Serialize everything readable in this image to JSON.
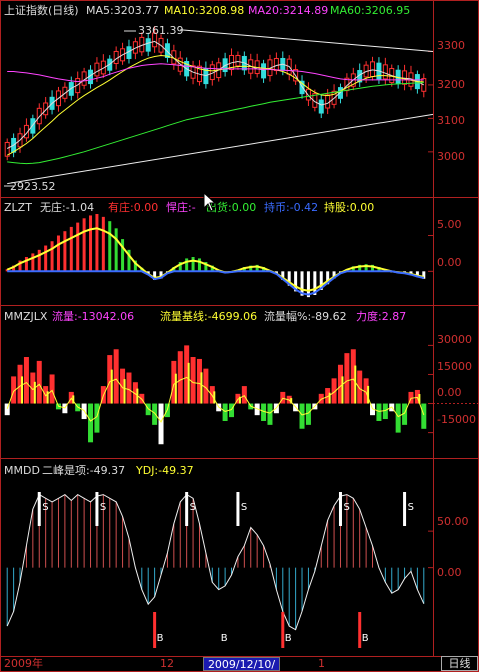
{
  "panels": {
    "main": {
      "title": "上证指数(日线)",
      "ma5": "MA5:3203.77",
      "ma10": "MA10:3208.98",
      "ma20": "MA20:3214.89",
      "ma60": "MA60:3206.95",
      "high_label": "3361.39",
      "low_label": "2923.52",
      "y_ticks": [
        "3300",
        "3200",
        "3100",
        "3000"
      ]
    },
    "zlzt": {
      "name": "ZLZT",
      "wuzhuang": "无庄:-1.04",
      "youzhuang": "有庄:0.00",
      "hanzhuang": "悍庄:-",
      "chuhuo": "出货:0.00",
      "shishi": "持币:-0.42",
      "chigu": "持股:0.00",
      "y_ticks": [
        "5.00",
        "0.00"
      ]
    },
    "mmzjlx": {
      "name": "MMZJLX",
      "liuliang": "流量:-13042.06",
      "jixian": "流量基线:-4699.06",
      "fu": "流量幅%:-89.62",
      "lidu": "力度:2.87",
      "y_ticks": [
        "30000",
        "15000",
        "0.00",
        "-15000"
      ]
    },
    "mmdd": {
      "name": "MMDD",
      "erfeng": "二峰是项:-49.37",
      "ydj": "YDJ:-49.37",
      "y_ticks": [
        "50.00",
        "0.00"
      ],
      "s_mark": "S",
      "b_mark": "B"
    }
  },
  "bottom_bar": {
    "year": "2009年",
    "m12": "12",
    "date": "2009/12/10/四",
    "m1": "1",
    "period": "日线"
  },
  "colors": {
    "up": "#ff3030",
    "down": "#33dddd",
    "green_bar": "#33dd33",
    "yellow": "#ffff33",
    "red_axis": "#b02020"
  },
  "chart_data": [
    {
      "type": "candlestick",
      "title": "上证指数(日线)",
      "ylim": [
        2880,
        3400
      ],
      "y_ticks": [
        3000,
        3100,
        3200,
        3300
      ],
      "series": [
        {
          "name": "MA5",
          "values": [
            3010,
            3020,
            3035,
            3055,
            3080,
            3105,
            3125,
            3145,
            3160,
            3175,
            3190,
            3200,
            3215,
            3228,
            3240,
            3250,
            3262,
            3278,
            3290,
            3300,
            3310,
            3318,
            3325,
            3330,
            3318,
            3300,
            3280,
            3262,
            3248,
            3238,
            3232,
            3228,
            3235,
            3245,
            3258,
            3266,
            3270,
            3266,
            3256,
            3248,
            3245,
            3250,
            3258,
            3262,
            3255,
            3228,
            3195,
            3168,
            3150,
            3140,
            3145,
            3160,
            3178,
            3198,
            3215,
            3230,
            3240,
            3245,
            3242,
            3235,
            3228,
            3222,
            3220,
            3218,
            3210,
            3200
          ]
        },
        {
          "name": "MA10",
          "values": [
            2990,
            3000,
            3012,
            3025,
            3040,
            3058,
            3075,
            3092,
            3110,
            3125,
            3140,
            3155,
            3168,
            3180,
            3192,
            3203,
            3215,
            3228,
            3240,
            3252,
            3262,
            3272,
            3280,
            3285,
            3288,
            3286,
            3280,
            3270,
            3262,
            3255,
            3248,
            3244,
            3242,
            3245,
            3248,
            3252,
            3255,
            3256,
            3255,
            3252,
            3250,
            3248,
            3245,
            3240,
            3232,
            3220,
            3205,
            3190,
            3178,
            3170,
            3168,
            3172,
            3182,
            3192,
            3202,
            3212,
            3220,
            3225,
            3228,
            3228,
            3226,
            3222,
            3218,
            3214,
            3210,
            3209
          ]
        },
        {
          "name": "MA20",
          "values": [
            3240,
            3240,
            3238,
            3236,
            3233,
            3230,
            3226,
            3222,
            3218,
            3215,
            3212,
            3210,
            3212,
            3215,
            3220,
            3225,
            3232,
            3238,
            3244,
            3250,
            3254,
            3258,
            3260,
            3262,
            3263,
            3262,
            3260,
            3258,
            3256,
            3254,
            3252,
            3250,
            3249,
            3248,
            3248,
            3248,
            3248,
            3248,
            3248,
            3248,
            3247,
            3246,
            3245,
            3244,
            3243,
            3242,
            3240,
            3237,
            3234,
            3230,
            3226,
            3222,
            3218,
            3216,
            3215,
            3215,
            3215,
            3215,
            3215,
            3215,
            3215,
            3215,
            3215,
            3215,
            3215,
            3215
          ]
        },
        {
          "name": "MA60",
          "values": [
            2970,
            2968,
            2966,
            2965,
            2966,
            2968,
            2972,
            2976,
            2980,
            2985,
            2990,
            2995,
            3000,
            3006,
            3012,
            3018,
            3024,
            3030,
            3036,
            3042,
            3048,
            3054,
            3060,
            3066,
            3072,
            3078,
            3084,
            3090,
            3096,
            3100,
            3104,
            3108,
            3112,
            3116,
            3120,
            3124,
            3128,
            3132,
            3136,
            3140,
            3144,
            3148,
            3151,
            3154,
            3157,
            3160,
            3163,
            3166,
            3169,
            3172,
            3175,
            3178,
            3181,
            3184,
            3187,
            3190,
            3193,
            3196,
            3198,
            3200,
            3202,
            3203,
            3204,
            3205,
            3206,
            3207
          ]
        }
      ],
      "annotations": [
        {
          "text": "3361.39",
          "value": 3361.39
        },
        {
          "text": "2923.52",
          "value": 2923.52
        }
      ]
    },
    {
      "type": "bar",
      "title": "ZLZT",
      "ylim": [
        -4,
        8
      ],
      "y_ticks": [
        0,
        5
      ],
      "series": [
        {
          "name": "无庄",
          "values": [
            0.3,
            0.8,
            1.5,
            2.0,
            2.5,
            3.0,
            3.6,
            4.2,
            5.0,
            5.6,
            6.2,
            6.8,
            7.4,
            7.8,
            8.0,
            7.6,
            7.0,
            6.0,
            4.5,
            3.0,
            1.5,
            0.5,
            -0.5,
            -1.2,
            -1.0,
            -0.3,
            0.6,
            1.3,
            1.8,
            2.0,
            1.8,
            1.3,
            0.8,
            0.2,
            -0.2,
            -0.1,
            0.2,
            0.6,
            0.8,
            0.9,
            0.6,
            0.1,
            -0.4,
            -1.2,
            -2.0,
            -2.8,
            -3.4,
            -3.6,
            -3.3,
            -2.6,
            -1.8,
            -1.0,
            -0.3,
            0.3,
            0.7,
            0.9,
            1.0,
            0.9,
            0.6,
            0.3,
            0.0,
            -0.2,
            -0.3,
            -0.5,
            -0.8,
            -1.04
          ]
        }
      ]
    },
    {
      "type": "bar",
      "title": "MMZJLX",
      "ylim": [
        -25000,
        40000
      ],
      "y_ticks": [
        -15000,
        0,
        15000,
        30000
      ],
      "series": [
        {
          "name": "流量",
          "values": [
            -6000,
            14000,
            20000,
            24000,
            16000,
            22000,
            9000,
            15000,
            -3000,
            -5000,
            6000,
            -4000,
            -8000,
            -20000,
            -15000,
            9000,
            25000,
            28000,
            18000,
            16000,
            11000,
            5000,
            -6000,
            -11000,
            -21000,
            -7000,
            22000,
            27000,
            30000,
            24000,
            23000,
            18000,
            9000,
            -4000,
            -9000,
            -7000,
            5000,
            9000,
            -3000,
            -6000,
            -9000,
            -11000,
            -5000,
            6000,
            4000,
            -4000,
            -13000,
            -11000,
            -3000,
            5000,
            8000,
            13000,
            20000,
            26000,
            28000,
            17000,
            13000,
            -6000,
            -9000,
            -8000,
            -4000,
            -15000,
            -11000,
            6000,
            7000,
            -13042
          ]
        }
      ],
      "baseline": {
        "name": "流量基线",
        "last": -4699.06
      }
    },
    {
      "type": "line",
      "title": "MMDD",
      "ylim": [
        -110,
        120
      ],
      "y_ticks": [
        0,
        50
      ],
      "series": [
        {
          "name": "二峰是项",
          "values": [
            -80,
            -60,
            -20,
            30,
            80,
            100,
            95,
            90,
            95,
            100,
            92,
            100,
            95,
            90,
            98,
            100,
            95,
            90,
            70,
            40,
            0,
            -30,
            -50,
            -40,
            -10,
            20,
            60,
            90,
            100,
            95,
            60,
            20,
            -20,
            -30,
            -25,
            -10,
            15,
            30,
            55,
            45,
            30,
            5,
            -30,
            -60,
            -80,
            -85,
            -60,
            -30,
            -5,
            30,
            65,
            85,
            98,
            100,
            95,
            80,
            55,
            30,
            0,
            -20,
            -35,
            -30,
            -15,
            -5,
            -30,
            -49.37
          ]
        }
      ]
    }
  ]
}
